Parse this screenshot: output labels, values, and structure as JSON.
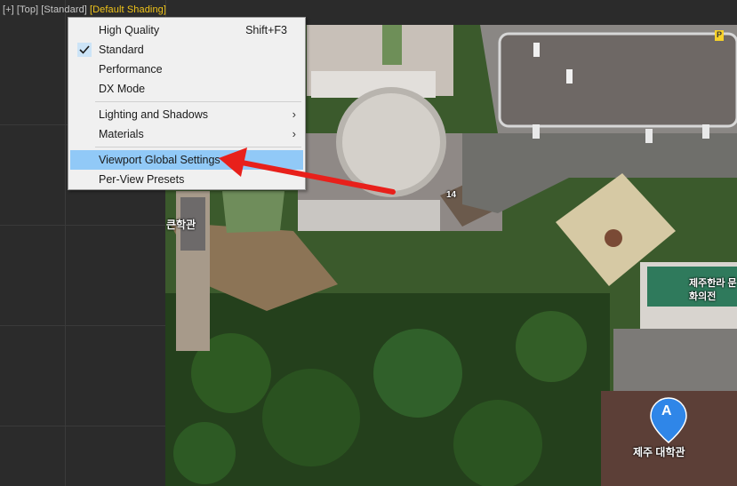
{
  "viewport": {
    "label": {
      "plus": "[+]",
      "view": "[Top]",
      "mode": "[Standard]",
      "shading": "[Default Shading]"
    }
  },
  "menu": {
    "items": [
      {
        "label": "High Quality",
        "shortcut": "Shift+F3"
      },
      {
        "label": "Standard",
        "checked": true
      },
      {
        "label": "Performance"
      },
      {
        "label": "DX Mode"
      },
      {
        "label": "Lighting and Shadows",
        "submenu": true
      },
      {
        "label": "Materials",
        "submenu": true
      },
      {
        "label": "Viewport Global Settings",
        "highlighted": true
      },
      {
        "label": "Per-View Presets"
      }
    ]
  },
  "map": {
    "labels": {
      "left_building": "큰학관",
      "center_building": "14",
      "right_building": "제주한라 문화의전",
      "marker_caption": "제주 대학관"
    },
    "marker_letter": "A",
    "parking_badge": "P"
  },
  "colors": {
    "accent_highlight": "#91c9f7",
    "shading_label": "#f0c419",
    "arrow": "#e8201b",
    "marker": "#2f86e8"
  }
}
